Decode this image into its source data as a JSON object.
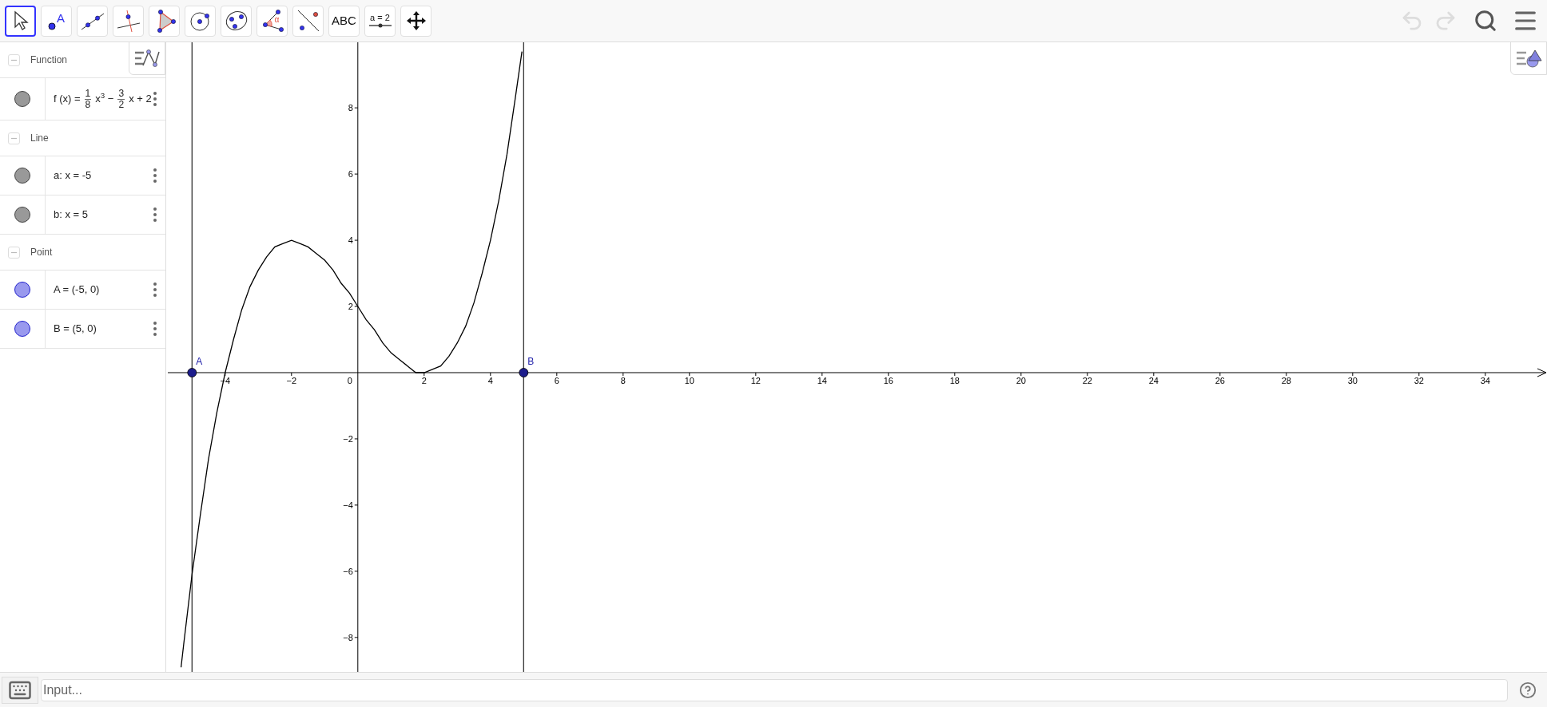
{
  "toolbar": {
    "tools": [
      {
        "kind": "move",
        "selected": true
      },
      {
        "kind": "point",
        "selected": false,
        "label": "A"
      },
      {
        "kind": "line",
        "selected": false
      },
      {
        "kind": "perpendicular",
        "selected": false
      },
      {
        "kind": "polygon",
        "selected": false
      },
      {
        "kind": "circle",
        "selected": false
      },
      {
        "kind": "conic",
        "selected": false
      },
      {
        "kind": "angle",
        "selected": false,
        "label": "α"
      },
      {
        "kind": "reflect",
        "selected": false
      },
      {
        "kind": "text",
        "selected": false,
        "label": "ABC"
      },
      {
        "kind": "slider",
        "selected": false,
        "label": "a = 2"
      },
      {
        "kind": "pan",
        "selected": false
      }
    ],
    "undo": {
      "disabled": true
    },
    "redo": {
      "disabled": true
    }
  },
  "algebra": {
    "groups": [
      {
        "title": "Function",
        "expanded": true,
        "items": [
          {
            "kind": "formula",
            "color": "#999999",
            "parts": [
              {
                "kind": "text",
                "text": "f (x) ="
              },
              {
                "kind": "frac",
                "num": "1",
                "den": "8"
              },
              {
                "kind": "text",
                "text": "x$^{3}$ −"
              },
              {
                "kind": "frac",
                "num": "3",
                "den": "2"
              },
              {
                "kind": "text",
                "text": "x + 2"
              }
            ]
          }
        ]
      },
      {
        "title": "Line",
        "expanded": true,
        "items": [
          {
            "kind": "text",
            "color": "#999999",
            "text": "a: x = -5"
          },
          {
            "kind": "text",
            "color": "#999999",
            "text": "b: x = 5"
          }
        ]
      },
      {
        "title": "Point",
        "expanded": true,
        "items": [
          {
            "kind": "text",
            "color": "#9999ee",
            "text": "A = (-5, 0)"
          },
          {
            "kind": "text",
            "color": "#9999ee",
            "text": "B = (5, 0)"
          }
        ]
      }
    ]
  },
  "graphics": {
    "origin_label": "0",
    "chart_data": {
      "type": "line",
      "x": [
        -5.33,
        -5.25,
        -5,
        -4.75,
        -4.5,
        -4.25,
        -4,
        -3.75,
        -3.5,
        -3.25,
        -3,
        -2.75,
        -2.5,
        -2.25,
        -2,
        -1.75,
        -1.5,
        -1.25,
        -1,
        -0.75,
        -0.5,
        -0.25,
        0,
        0.25,
        0.5,
        0.75,
        1,
        1.25,
        1.5,
        1.75,
        2,
        2.25,
        2.5,
        2.75,
        3,
        3.25,
        3.5,
        3.75,
        4,
        4.25,
        4.5,
        4.75,
        4.95
      ],
      "series": [
        {
          "color": "#000000",
          "values": [
            -8.9,
            -8.2,
            -6.1,
            -4.3,
            -2.6,
            -1.2,
            0,
            1,
            1.9,
            2.6,
            3.1,
            3.5,
            3.8,
            3.9,
            4,
            3.9,
            3.8,
            3.6,
            3.4,
            3.1,
            2.7,
            2.4,
            2,
            1.6,
            1.3,
            0.9,
            0.6,
            0.4,
            0.2,
            0,
            0,
            0.1,
            0.2,
            0.5,
            0.9,
            1.4,
            2.1,
            3,
            4,
            5.2,
            6.6,
            8.3,
            9.7
          ]
        }
      ],
      "xlim": [
        -5.73,
        35.86
      ],
      "ylim": [
        -9.04,
        9.98
      ],
      "xticks": [
        {
          "value": -4,
          "label": "−4"
        },
        {
          "value": -2,
          "label": "−2"
        },
        {
          "value": 2,
          "label": "2"
        },
        {
          "value": 4,
          "label": "4"
        },
        {
          "value": 6,
          "label": "6"
        },
        {
          "value": 8,
          "label": "8"
        },
        {
          "value": 10,
          "label": "10"
        },
        {
          "value": 12,
          "label": "12"
        },
        {
          "value": 14,
          "label": "14"
        },
        {
          "value": 16,
          "label": "16"
        },
        {
          "value": 18,
          "label": "18"
        },
        {
          "value": 20,
          "label": "20"
        },
        {
          "value": 22,
          "label": "22"
        },
        {
          "value": 24,
          "label": "24"
        },
        {
          "value": 26,
          "label": "26"
        },
        {
          "value": 28,
          "label": "28"
        },
        {
          "value": 30,
          "label": "30"
        },
        {
          "value": 32,
          "label": "32"
        },
        {
          "value": 34,
          "label": "34"
        }
      ],
      "yticks": [
        {
          "value": -8,
          "label": "−8"
        },
        {
          "value": -6,
          "label": "−6"
        },
        {
          "value": -4,
          "label": "−4"
        },
        {
          "value": -2,
          "label": "−2"
        },
        {
          "value": 2,
          "label": "2"
        },
        {
          "value": 4,
          "label": "4"
        },
        {
          "value": 6,
          "label": "6"
        },
        {
          "value": 8,
          "label": "8"
        }
      ],
      "ref_lines": [
        {
          "axis": "x",
          "value": -5
        },
        {
          "axis": "x",
          "value": 5
        }
      ],
      "annotations": [
        {
          "text": "A",
          "x": -5,
          "y": 0
        },
        {
          "text": "B",
          "x": 5,
          "y": 0
        }
      ]
    }
  },
  "input": {
    "placeholder": "Input..."
  }
}
